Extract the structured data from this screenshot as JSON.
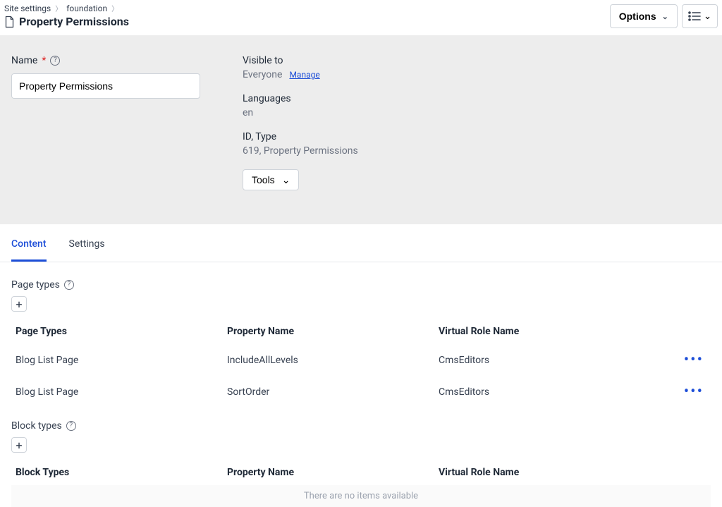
{
  "breadcrumb": {
    "item1": "Site settings",
    "item2": "foundation"
  },
  "page_title": "Property Permissions",
  "top": {
    "options_label": "Options"
  },
  "form": {
    "name_label": "Name",
    "name_value": "Property Permissions",
    "visible_label": "Visible to",
    "visible_value": "Everyone",
    "manage_link": "Manage",
    "languages_label": "Languages",
    "languages_value": "en",
    "idtype_label": "ID, Type",
    "idtype_value": "619, Property Permissions",
    "tools_label": "Tools"
  },
  "tabs": {
    "content": "Content",
    "settings": "Settings"
  },
  "page_types": {
    "section_label": "Page types",
    "headers": {
      "col1": "Page Types",
      "col2": "Property Name",
      "col3": "Virtual Role Name"
    },
    "rows": [
      {
        "type": "Blog List Page",
        "prop": "IncludeAllLevels",
        "role": "CmsEditors"
      },
      {
        "type": "Blog List Page",
        "prop": "SortOrder",
        "role": "CmsEditors"
      }
    ]
  },
  "block_types": {
    "section_label": "Block types",
    "headers": {
      "col1": "Block Types",
      "col2": "Property Name",
      "col3": "Virtual Role Name"
    },
    "empty_text": "There are no items available"
  }
}
